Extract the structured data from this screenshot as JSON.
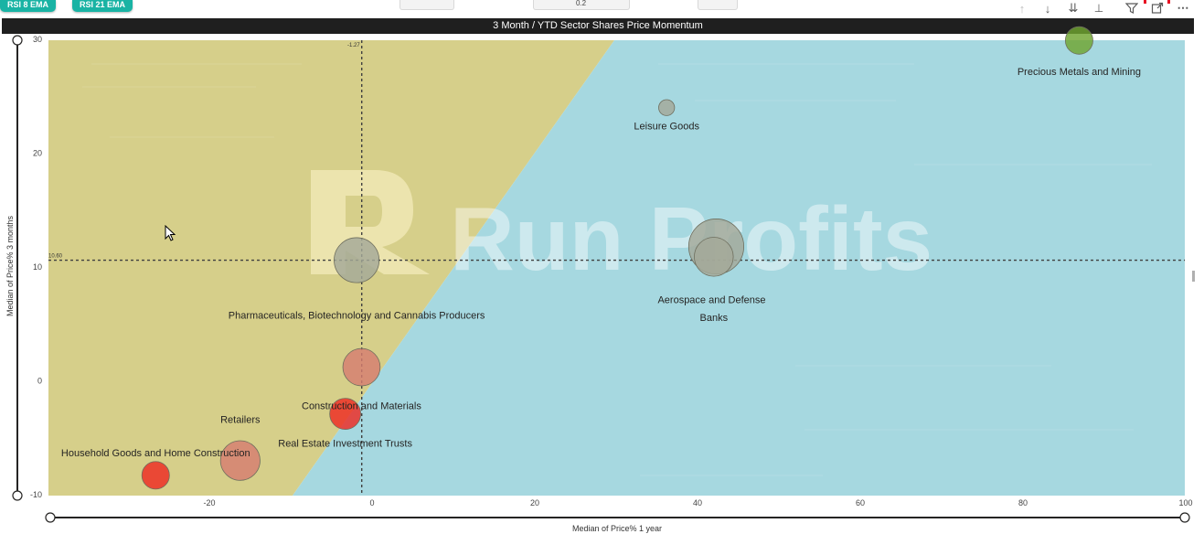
{
  "toolbar": {
    "pills": [
      "RSI 8 EMA",
      "RSI 21 EMA"
    ],
    "slicer_value": "0.2",
    "icons": [
      "arrow-up-icon",
      "arrow-down-icon",
      "double-arrow-down-icon",
      "expand-hierarchy-icon",
      "filter-icon",
      "focus-mode-icon",
      "more-options-icon"
    ]
  },
  "visual": {
    "title": "3 Month / YTD Sector Shares Price Momentum",
    "watermark": "Run Profits"
  },
  "chart_data": {
    "type": "scatter",
    "variant": "bubble",
    "title": "3 Month / YTD Sector Shares Price Momentum",
    "xlabel": "Median of Price% 1 year",
    "ylabel": "Median of Price% 3 months",
    "xlim": [
      -40,
      100
    ],
    "ylim": [
      -10,
      30
    ],
    "x_ticks": [
      -20,
      0,
      20,
      40,
      60,
      80,
      100
    ],
    "y_ticks": [
      -10,
      0,
      10,
      20,
      30
    ],
    "reference_lines": [
      {
        "axis": "x",
        "value": -1.27,
        "label": "-1.27"
      },
      {
        "axis": "y",
        "value": 10.6,
        "label": "10.60"
      }
    ],
    "background": {
      "upper_left_color": "#d6cf8a",
      "lower_right_color": "#a6d8e0"
    },
    "grid": false,
    "points": [
      {
        "name": "Precious Metals and Mining",
        "x": 86.9,
        "y": 29.9,
        "size": 3,
        "color": "#6fa52f"
      },
      {
        "name": "Leisure Goods",
        "x": 36.2,
        "y": 24.0,
        "size": 1,
        "color": "#a4a898"
      },
      {
        "name": "Aerospace and Defense",
        "x": 42.3,
        "y": 11.8,
        "size": 12,
        "color": "#a4a898"
      },
      {
        "name": "Banks",
        "x": 42.0,
        "y": 10.9,
        "size": 6,
        "color": "#a4a898"
      },
      {
        "name": "Pharmaceuticals, Biotechnology and Cannabis Producers",
        "x": -1.9,
        "y": 10.6,
        "size": 8,
        "color": "#a4a898"
      },
      {
        "name": "Construction and Materials",
        "x": -1.3,
        "y": 1.2,
        "size": 5.5,
        "color": "#d67d70"
      },
      {
        "name": "Real Estate Investment Trusts",
        "x": -3.3,
        "y": -2.9,
        "size": 3.8,
        "color": "#ee2a22"
      },
      {
        "name": "Retailers",
        "x": -16.2,
        "y": -7.0,
        "size": 6.2,
        "color": "#d67d70"
      },
      {
        "name": "Household Goods and Home Construction",
        "x": -26.6,
        "y": -8.3,
        "size": 3,
        "color": "#ee2a22"
      }
    ]
  }
}
